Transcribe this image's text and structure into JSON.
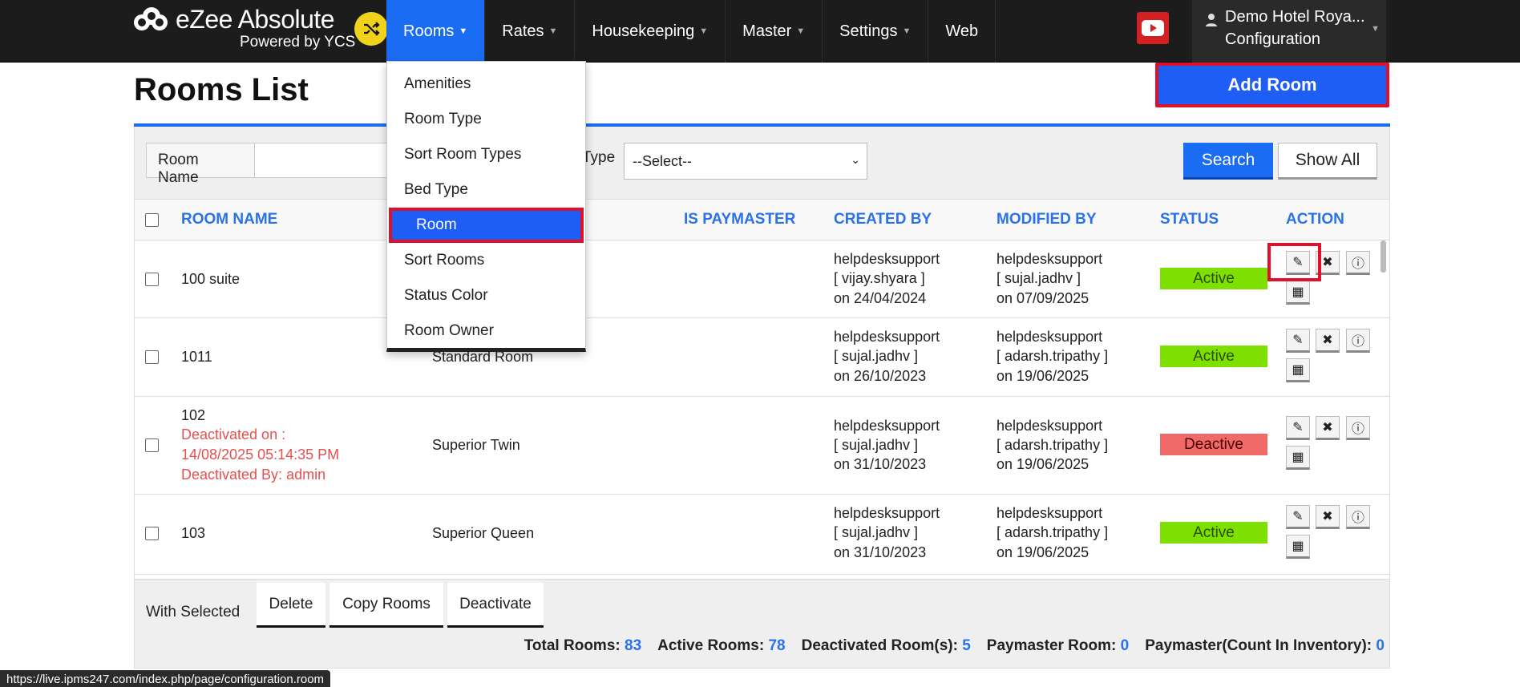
{
  "brand": {
    "title": "eZee Absolute",
    "subtitle": "Powered by YCS"
  },
  "nav": {
    "items": [
      {
        "label": "Rooms",
        "active": true
      },
      {
        "label": "Rates"
      },
      {
        "label": "Housekeeping"
      },
      {
        "label": "Master"
      },
      {
        "label": "Settings"
      },
      {
        "label": "Web",
        "no_caret": true
      }
    ]
  },
  "hotel": {
    "name": "Demo Hotel Roya...",
    "section": "Configuration"
  },
  "dropdown": {
    "items": [
      "Amenities",
      "Room Type",
      "Sort Room Types",
      "Bed Type",
      "Room",
      "Sort Rooms",
      "Status Color",
      "Room Owner"
    ],
    "selected": "Room"
  },
  "page": {
    "title": "Rooms List",
    "add_button": "Add Room"
  },
  "search": {
    "room_name_label": "Room Name",
    "room_name_value": "",
    "type_label": "Type",
    "select_value": "--Select--",
    "search_button": "Search",
    "show_all_button": "Show All"
  },
  "table": {
    "headers": {
      "room_name": "ROOM NAME",
      "is_paymaster": "IS PAYMASTER",
      "created_by": "CREATED BY",
      "modified_by": "MODIFIED BY",
      "status": "STATUS",
      "action": "ACTION"
    },
    "rows": [
      {
        "name": "100 suite",
        "type": "",
        "c_user": "helpdesksupport",
        "c_by": "[ vijay.shyara ]",
        "c_on": "on 24/04/2024",
        "m_user": "helpdesksupport",
        "m_by": "[ sujal.jadhv ]",
        "m_on": "on 07/09/2025",
        "status": "Active"
      },
      {
        "name": "1011",
        "type": "Standard Room",
        "c_user": "helpdesksupport",
        "c_by": "[ sujal.jadhv ]",
        "c_on": "on 26/10/2023",
        "m_user": "helpdesksupport",
        "m_by": "[ adarsh.tripathy ]",
        "m_on": "on 19/06/2025",
        "status": "Active"
      },
      {
        "name": "102",
        "deact_line1": "Deactivated on :",
        "deact_line2": "14/08/2025 05:14:35 PM",
        "deact_line3": "Deactivated By: admin",
        "type": "Superior Twin",
        "c_user": "helpdesksupport",
        "c_by": "[ sujal.jadhv ]",
        "c_on": "on 31/10/2023",
        "m_user": "helpdesksupport",
        "m_by": "[ adarsh.tripathy ]",
        "m_on": "on 19/06/2025",
        "status": "Deactive"
      },
      {
        "name": "103",
        "type": "Superior Queen",
        "c_user": "helpdesksupport",
        "c_by": "[ sujal.jadhv ]",
        "c_on": "on 31/10/2023",
        "m_user": "helpdesksupport",
        "m_by": "[ adarsh.tripathy ]",
        "m_on": "on 19/06/2025",
        "status": "Active"
      }
    ]
  },
  "footer": {
    "with_selected": "With Selected",
    "buttons": [
      "Delete",
      "Copy Rooms",
      "Deactivate"
    ],
    "totals": [
      {
        "label": "Total Rooms:",
        "value": "83"
      },
      {
        "label": "Active Rooms:",
        "value": "78"
      },
      {
        "label": "Deactivated Room(s):",
        "value": "5"
      },
      {
        "label": "Paymaster Room:",
        "value": "0"
      },
      {
        "label": "Paymaster(Count In Inventory):",
        "value": "0"
      }
    ]
  },
  "status_url": "https://live.ipms247.com/index.php/page/configuration.room",
  "colors": {
    "accent": "#1a6df2",
    "highlight": "#e0102a",
    "active": "#7ee000",
    "deactive": "#f06a6a"
  }
}
